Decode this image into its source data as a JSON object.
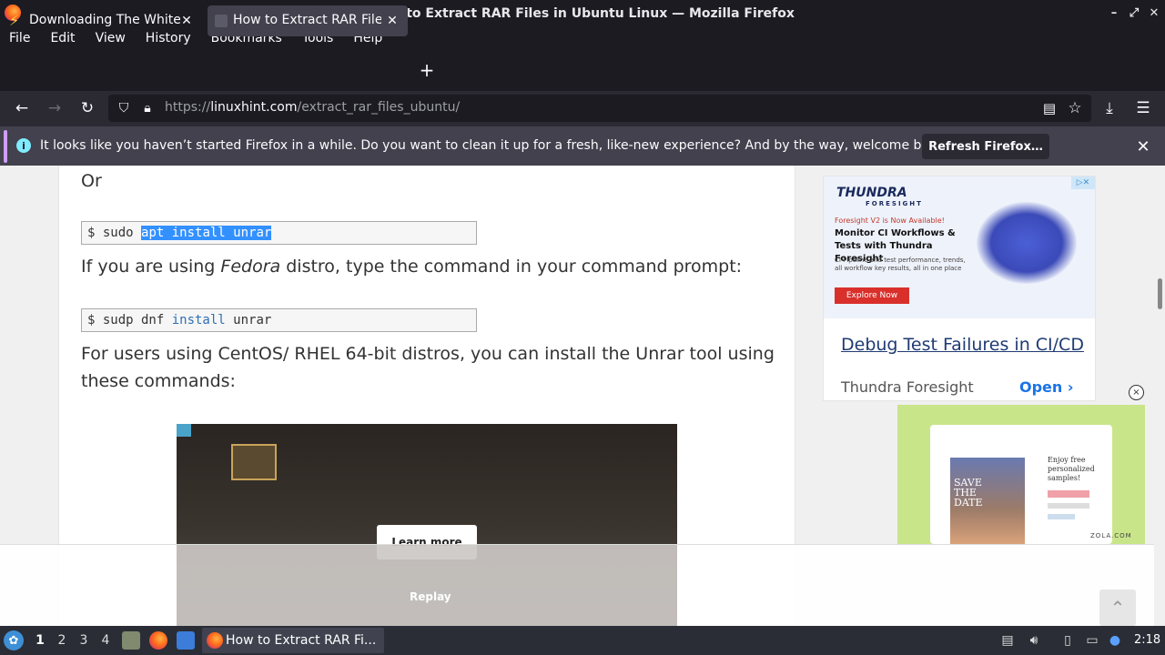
{
  "window": {
    "title": "How to Extract RAR Files in Ubuntu Linux — Mozilla Firefox",
    "minimize_glyph": "–",
    "maximize_glyph": "⤢",
    "close_glyph": "✕"
  },
  "menu": [
    "File",
    "Edit",
    "View",
    "History",
    "Bookmarks",
    "Tools",
    "Help"
  ],
  "tabs": [
    {
      "label": "Downloading The White House",
      "icon": "bolt-icon",
      "active": false
    },
    {
      "label": "How to Extract RAR Files in Ubuntu Linux",
      "icon": "linuxhint-icon",
      "active": true
    }
  ],
  "newtab_glyph": "+",
  "url": {
    "prefix": "https://",
    "host": "linuxhint.com",
    "path": "/extract_rar_files_ubuntu/"
  },
  "notification": {
    "message": "It looks like you haven’t started Firefox in a while. Do you want to clean it up for a fresh, like-new experience? And by the way, welcome back!",
    "button": "Refresh Firefox…",
    "info_glyph": "i",
    "close_glyph": "✕"
  },
  "article": {
    "or_text": "Or",
    "code1": {
      "prompt": "$ ",
      "cmd": "sudo ",
      "highlighted": "apt install unrar"
    },
    "fedora_pre": "If you are using ",
    "fedora_em": "Fedora",
    "fedora_post": " distro, type the command in your command prompt:",
    "code2": {
      "prompt": "$ ",
      "cmd1": "sudp dnf ",
      "kw": "install",
      "cmd2": " unrar"
    },
    "centos_line1": "For users using CentOS/ RHEL 64-bit distros, you can install the Unrar tool using",
    "centos_line2": "these commands:"
  },
  "video_ad": {
    "learn_more": "Learn more",
    "replay": "Replay"
  },
  "ad_thundra": {
    "brand": "THUNDRA",
    "brand_sub": "FORESIGHT",
    "sub": "Foresight V2 is Now Available!",
    "headline": "Monitor CI Workflows & Tests with Thundra Foresight",
    "desc": "CI Pipeline and test performance, trends, all workflow key results, all in one place",
    "cta": "Explore Now",
    "link": "Debug Test Failures in CI/CD",
    "advertiser": "Thundra Foresight",
    "open": "Open",
    "open_glyph": "›",
    "adchoices": "▷✕"
  },
  "ad_close_glyph": "×",
  "ad_zola": {
    "save1": "SAVE",
    "save2": "THE",
    "save3": "DATE",
    "enjoy": "Enjoy free personalized samples!",
    "brand": "ZOLA.COM"
  },
  "scroll_top_glyph": "⌃",
  "taskbar": {
    "workspaces": [
      "1",
      "2",
      "3",
      "4"
    ],
    "active_task": "How to Extract RAR Fi...",
    "clock": "2:18"
  }
}
